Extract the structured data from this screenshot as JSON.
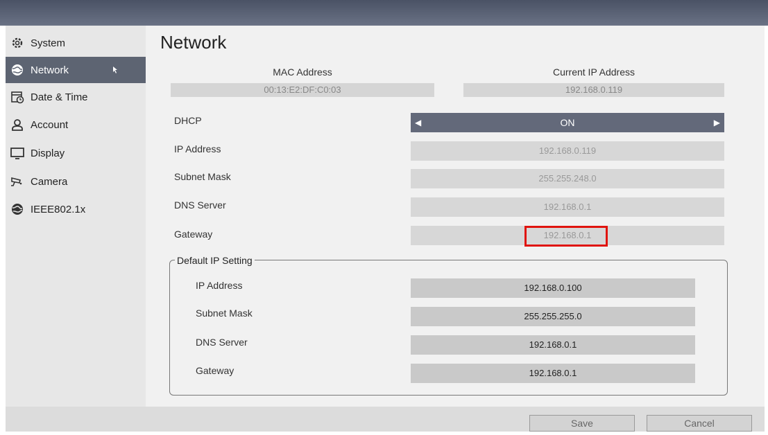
{
  "sidebar": {
    "items": [
      {
        "label": "System",
        "icon": "gear-icon"
      },
      {
        "label": "Network",
        "icon": "globe-icon"
      },
      {
        "label": "Date & Time",
        "icon": "calendar-clock-icon"
      },
      {
        "label": "Account",
        "icon": "user-icon"
      },
      {
        "label": "Display",
        "icon": "monitor-icon"
      },
      {
        "label": "Camera",
        "icon": "camera-icon"
      },
      {
        "label": "IEEE802.1x",
        "icon": "globe-icon"
      }
    ],
    "active": "Network"
  },
  "page": {
    "title": "Network"
  },
  "info": {
    "mac_label": "MAC Address",
    "mac_value": "00:13:E2:DF:C0:03",
    "ip_label": "Current IP Address",
    "ip_value": "192.168.0.119"
  },
  "settings": {
    "dhcp_label": "DHCP",
    "dhcp_value": "ON",
    "ip_label": "IP Address",
    "ip_value": "192.168.0.119",
    "subnet_label": "Subnet Mask",
    "subnet_value": "255.255.248.0",
    "dns_label": "DNS Server",
    "dns_value": "192.168.0.1",
    "gateway_label": "Gateway",
    "gateway_value": "192.168.0.1"
  },
  "default_ip": {
    "title": "Default IP Setting",
    "ip_label": "IP Address",
    "ip_value": "192.168.0.100",
    "subnet_label": "Subnet Mask",
    "subnet_value": "255.255.255.0",
    "dns_label": "DNS Server",
    "dns_value": "192.168.0.1",
    "gateway_label": "Gateway",
    "gateway_value": "192.168.0.1"
  },
  "buttons": {
    "save": "Save",
    "cancel": "Cancel"
  },
  "colors": {
    "active_nav": "#5d6472",
    "highlight": "#e0140e",
    "field": "#d7d7d7"
  }
}
